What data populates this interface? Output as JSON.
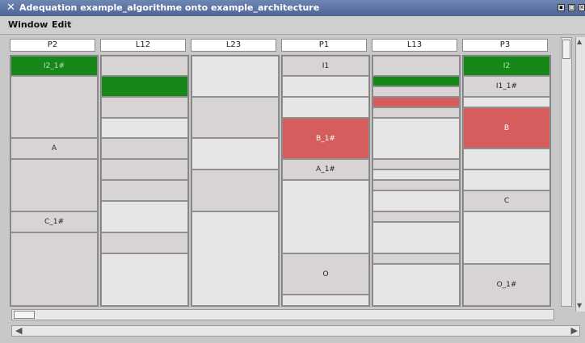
{
  "window": {
    "title": "Adequation example_algorithme onto example_architecture"
  },
  "menu": {
    "items": [
      "Window",
      "Edit"
    ]
  },
  "lanes": [
    {
      "name": "P2",
      "blocks": [
        {
          "label": "I2_1#",
          "color": "green",
          "start": 0,
          "end": 25
        },
        {
          "label": "",
          "color": "gray",
          "start": 25,
          "end": 102
        },
        {
          "label": "A",
          "color": "gray",
          "start": 102,
          "end": 128
        },
        {
          "label": "",
          "color": "gray",
          "start": 128,
          "end": 193
        },
        {
          "label": "C_1#",
          "color": "gray",
          "start": 193,
          "end": 219
        },
        {
          "label": "",
          "color": "gray",
          "start": 219,
          "end": 310
        }
      ]
    },
    {
      "name": "L12",
      "blocks": [
        {
          "label": "",
          "color": "gray",
          "start": 0,
          "end": 25
        },
        {
          "label": "",
          "color": "green",
          "start": 25,
          "end": 51
        },
        {
          "label": "",
          "color": "gray",
          "start": 51,
          "end": 77
        },
        {
          "label": "",
          "color": "light",
          "start": 77,
          "end": 102
        },
        {
          "label": "",
          "color": "gray",
          "start": 102,
          "end": 128
        },
        {
          "label": "",
          "color": "gray",
          "start": 128,
          "end": 154
        },
        {
          "label": "",
          "color": "gray",
          "start": 154,
          "end": 180
        },
        {
          "label": "",
          "color": "light",
          "start": 180,
          "end": 219
        },
        {
          "label": "",
          "color": "gray",
          "start": 219,
          "end": 245
        },
        {
          "label": "",
          "color": "light",
          "start": 245,
          "end": 310
        }
      ]
    },
    {
      "name": "L23",
      "blocks": [
        {
          "label": "",
          "color": "light",
          "start": 0,
          "end": 51
        },
        {
          "label": "",
          "color": "gray",
          "start": 51,
          "end": 102
        },
        {
          "label": "",
          "color": "light",
          "start": 102,
          "end": 141
        },
        {
          "label": "",
          "color": "gray",
          "start": 141,
          "end": 193
        },
        {
          "label": "",
          "color": "light",
          "start": 193,
          "end": 310
        }
      ]
    },
    {
      "name": "P1",
      "blocks": [
        {
          "label": "I1",
          "color": "gray",
          "start": 0,
          "end": 25
        },
        {
          "label": "",
          "color": "light",
          "start": 25,
          "end": 51
        },
        {
          "label": "",
          "color": "light",
          "start": 51,
          "end": 77
        },
        {
          "label": "B_1#",
          "color": "red",
          "start": 77,
          "end": 128
        },
        {
          "label": "A_1#",
          "color": "gray",
          "start": 128,
          "end": 154
        },
        {
          "label": "",
          "color": "light",
          "start": 154,
          "end": 245
        },
        {
          "label": "O",
          "color": "gray",
          "start": 245,
          "end": 296
        },
        {
          "label": "",
          "color": "light",
          "start": 296,
          "end": 310
        }
      ]
    },
    {
      "name": "L13",
      "blocks": [
        {
          "label": "",
          "color": "gray",
          "start": 0,
          "end": 25
        },
        {
          "label": "",
          "color": "green",
          "start": 25,
          "end": 38
        },
        {
          "label": "",
          "color": "gray",
          "start": 38,
          "end": 51
        },
        {
          "label": "",
          "color": "red",
          "start": 51,
          "end": 64
        },
        {
          "label": "",
          "color": "gray",
          "start": 64,
          "end": 77
        },
        {
          "label": "",
          "color": "light",
          "start": 77,
          "end": 128
        },
        {
          "label": "",
          "color": "gray",
          "start": 128,
          "end": 141
        },
        {
          "label": "",
          "color": "light",
          "start": 141,
          "end": 154
        },
        {
          "label": "",
          "color": "gray",
          "start": 154,
          "end": 167
        },
        {
          "label": "",
          "color": "light",
          "start": 167,
          "end": 193
        },
        {
          "label": "",
          "color": "gray",
          "start": 193,
          "end": 206
        },
        {
          "label": "",
          "color": "light",
          "start": 206,
          "end": 245
        },
        {
          "label": "",
          "color": "gray",
          "start": 245,
          "end": 258
        },
        {
          "label": "",
          "color": "light",
          "start": 258,
          "end": 310
        }
      ]
    },
    {
      "name": "P3",
      "blocks": [
        {
          "label": "I2",
          "color": "green",
          "start": 0,
          "end": 25
        },
        {
          "label": "I1_1#",
          "color": "gray",
          "start": 25,
          "end": 51
        },
        {
          "label": "",
          "color": "light",
          "start": 51,
          "end": 64
        },
        {
          "label": "B",
          "color": "red",
          "start": 64,
          "end": 115
        },
        {
          "label": "",
          "color": "light",
          "start": 115,
          "end": 141
        },
        {
          "label": "",
          "color": "light",
          "start": 141,
          "end": 167
        },
        {
          "label": "C",
          "color": "gray",
          "start": 167,
          "end": 193
        },
        {
          "label": "",
          "color": "light",
          "start": 193,
          "end": 258
        },
        {
          "label": "O_1#",
          "color": "gray",
          "start": 258,
          "end": 310
        }
      ]
    }
  ]
}
